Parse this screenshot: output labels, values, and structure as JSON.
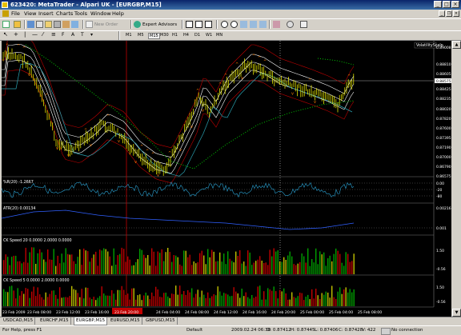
{
  "window": {
    "title": "623420: MetaTrader - Alpari UK - [EURGBP,M15]"
  },
  "menu": [
    "File",
    "View",
    "Insert",
    "Charts",
    "Tools",
    "Window",
    "Help"
  ],
  "toolbar": {
    "new_order": "New Order",
    "expert_advisors": "Expert Advisors"
  },
  "timeframes": [
    "M1",
    "M5",
    "M15",
    "M30",
    "H1",
    "H4",
    "D1",
    "W1",
    "MN"
  ],
  "chart": {
    "symbol_badge": "VolatilityScalp",
    "price_axis": [
      "0.89008",
      "0.88810",
      "0.88605",
      "0.88575",
      "0.88425",
      "0.88235",
      "0.88020",
      "0.87820",
      "0.87600",
      "0.87395",
      "0.87190",
      "0.87000",
      "0.86790",
      "0.86575",
      "0.86355",
      "0.86145",
      "0.85940"
    ],
    "current_price": "0.88575",
    "wpr": {
      "label": "%R(20) -1.2667",
      "levels": [
        "0.00",
        "-20",
        "-50",
        "-80",
        "-100"
      ]
    },
    "atr": {
      "label": "ATR(20) 0.00134",
      "levels": [
        "0.00216",
        "0.001",
        "0.00"
      ]
    },
    "ck1": {
      "label": "CK Speed 20 0.0000 2.0000 0.0000",
      "levels": [
        "1.50",
        "-0.56"
      ]
    },
    "ck2": {
      "label": "CK Speed 5 0.0000 2.0000 0.0000",
      "levels": [
        "1.50",
        "-0.56"
      ]
    },
    "time_axis": [
      "23 Feb 2009",
      "23 Feb 08:00",
      "23 Feb 12:00",
      "23 Feb 16:00",
      "23 Feb 20:00",
      "24 Feb 00:00",
      "24 Feb 04:00",
      "24 Feb 08:00",
      "24 Feb 12:00",
      "24 Feb 16:00",
      "24 Feb 20:00",
      "25 Feb 00:00",
      "25 Feb 04:00",
      "25 Feb 08:00"
    ]
  },
  "tabs": [
    "USDCAD,M15",
    "EURCHF,M15",
    "EURGBP,M15",
    "EURUSD,M15",
    "GBPUSD,M15"
  ],
  "active_tab": "EURGBP,M15",
  "status": {
    "help": "For Help, press F1",
    "profile": "Default",
    "datetime": "2009.02.24 06:30",
    "open": "O: 0.87412",
    "high": "H: 0.87445",
    "low": "L: 0.87406",
    "close": "C: 0.87428",
    "volume": "V: 422",
    "traffic": "1/0 kb",
    "connection": "No connection"
  }
}
